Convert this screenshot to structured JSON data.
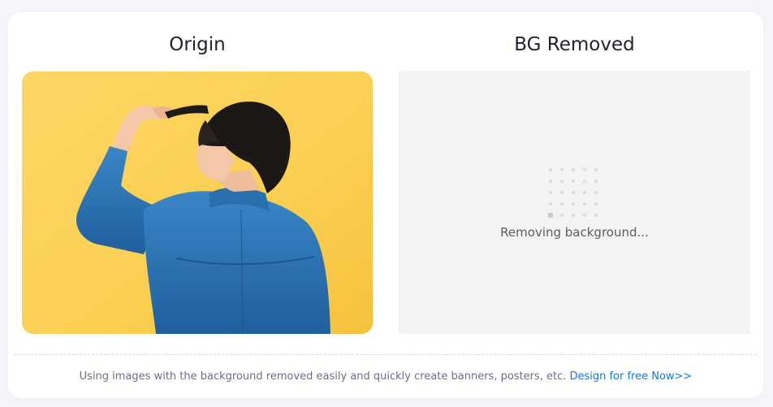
{
  "origin_panel": {
    "title": "Origin",
    "image_alt": "Person in denim jacket holding hair against yellow wall"
  },
  "result_panel": {
    "title": "BG Removed",
    "status": "Removing background..."
  },
  "footer": {
    "text": "Using images with the background removed easily and quickly create banners, posters, etc.",
    "link_label": "Design for free Now>>"
  },
  "colors": {
    "accent_link": "#1677e6",
    "photo_background": "#fbd159",
    "jacket": "#2f78b8"
  }
}
